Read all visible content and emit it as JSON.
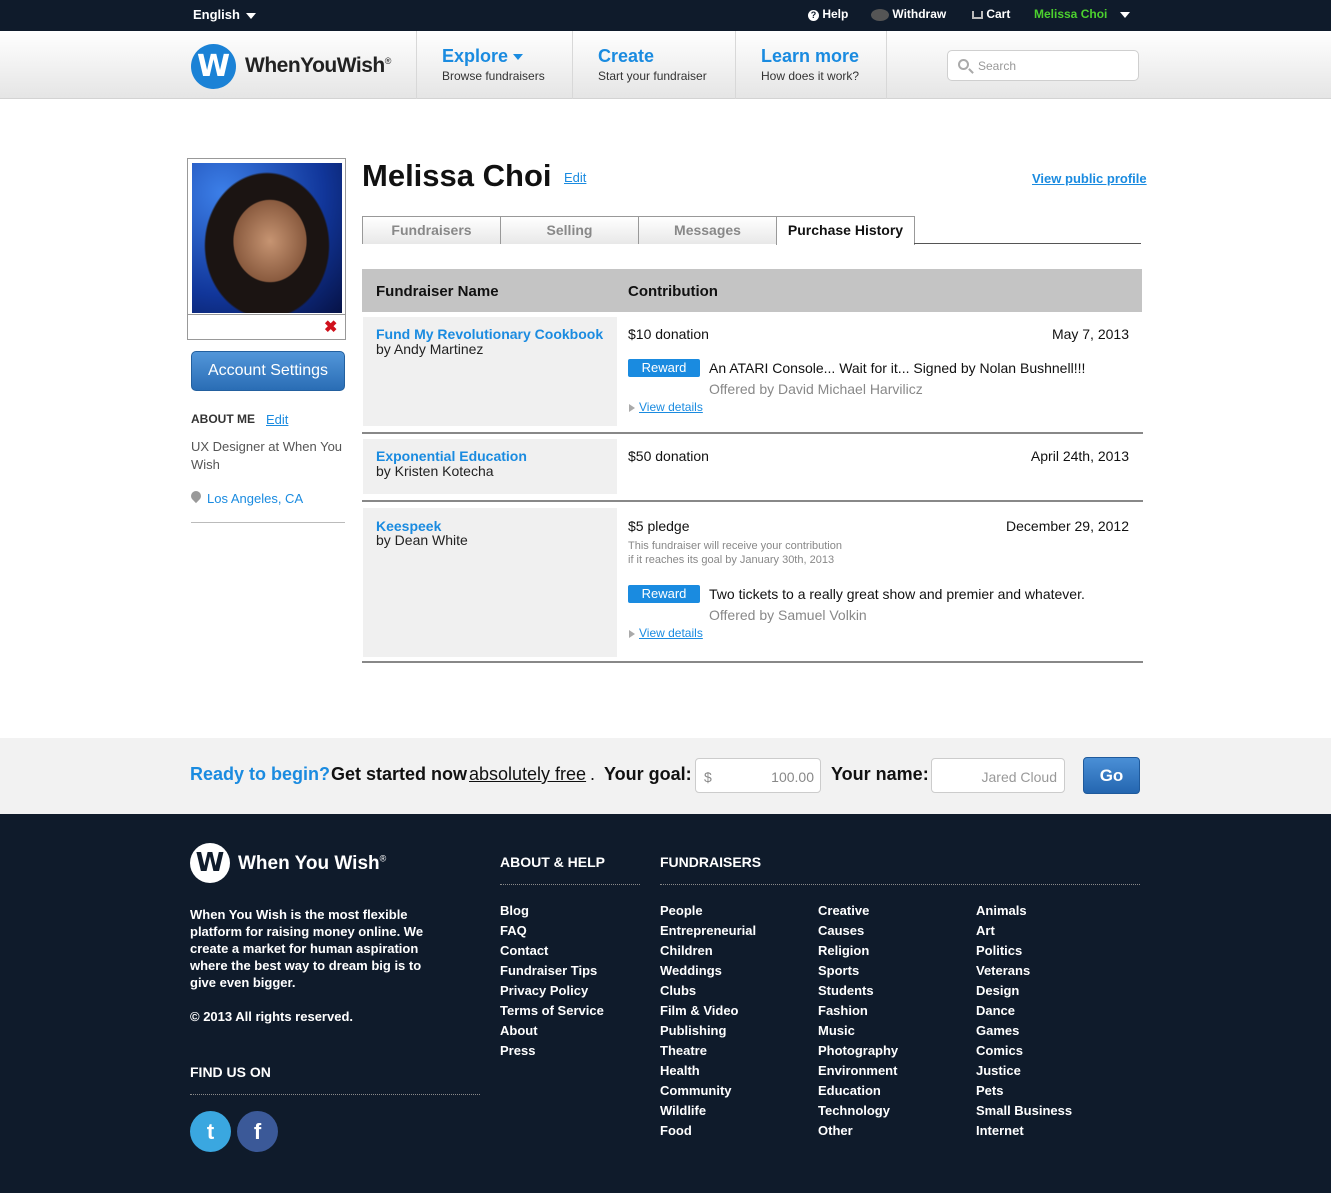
{
  "topbar": {
    "language": "English",
    "help": "Help",
    "withdraw": "Withdraw",
    "cart": "Cart",
    "user": "Melissa Choi"
  },
  "header": {
    "logo_letter": "W",
    "logo_text": "WhenYouWish",
    "registered": "®",
    "nav": [
      {
        "title": "Explore",
        "sub": "Browse fundraisers"
      },
      {
        "title": "Create",
        "sub": "Start your fundraiser"
      },
      {
        "title": "Learn more",
        "sub": "How does it work?"
      }
    ],
    "search_placeholder": "Search"
  },
  "sidebar": {
    "delete_icon": "✖",
    "account_settings": "Account Settings",
    "about_heading": "ABOUT ME",
    "about_edit": "Edit",
    "about_text": "UX Designer at When You Wish",
    "location": "Los Angeles, CA"
  },
  "profile": {
    "name": "Melissa Choi",
    "edit": "Edit",
    "view_public": "View public profile",
    "tabs": [
      "Fundraisers",
      "Selling",
      "Messages",
      "Purchase History"
    ],
    "active_tab": "Purchase History"
  },
  "table": {
    "headers": [
      "Fundraiser Name",
      "Contribution"
    ],
    "rows": [
      {
        "name": "Fund My Revolutionary Cookbook",
        "by": "by Andy Martinez",
        "amount": "$10 donation",
        "date": "May 7, 2013",
        "reward_label": "Reward",
        "reward": "An ATARI Console... Wait for it... Signed by Nolan Bushnell!!!",
        "offered": "Offered by David Michael Harvilicz",
        "view_details": "View details"
      },
      {
        "name": "Exponential Education",
        "by": "by Kristen Kotecha",
        "amount": "$50 donation",
        "date": "April 24th, 2013"
      },
      {
        "name": "Keespeek",
        "by": "by Dean White",
        "amount": "$5 pledge",
        "date": "December 29, 2012",
        "note_line1": "This fundraiser will receive your contribution",
        "note_line2": "if it reaches its goal by January 30th, 2013",
        "reward_label": "Reward",
        "reward": "Two tickets to a really great show and premier and whatever.",
        "offered": "Offered by Samuel Volkin",
        "view_details": "View details"
      }
    ]
  },
  "cta": {
    "ready": "Ready to begin?",
    "get_started": "Get started now",
    "free": "absolutely free",
    "dot": ".",
    "goal_label": "Your goal:",
    "currency": "$",
    "goal_value": "100.00",
    "name_label": "Your name:",
    "name_placeholder": "Jared Cloud",
    "go": "Go"
  },
  "footer": {
    "logo_letter": "W",
    "logo_text": "When You Wish",
    "registered": "®",
    "description": "When You Wish is the most flexible platform for raising money online. We create a market for human aspiration where the best way to dream big is to give even bigger.",
    "copyright": "© 2013 All rights reserved.",
    "find_us": "FIND US ON",
    "about_heading": "ABOUT & HELP",
    "about_links": [
      "Blog",
      "FAQ",
      "Contact",
      "Fundraiser Tips",
      "Privacy Policy",
      "Terms of Service",
      "About",
      "Press"
    ],
    "fundraisers_heading": "FUNDRAISERS",
    "fundraisers_col1": [
      "People",
      "Entrepreneurial",
      "Children",
      "Weddings",
      "Clubs",
      "Film & Video",
      "Publishing",
      "Theatre",
      "Health",
      "Community",
      "Wildlife",
      "Food"
    ],
    "fundraisers_col2": [
      "Creative",
      "Causes",
      "Religion",
      "Sports",
      "Students",
      "Fashion",
      "Music",
      "Photography",
      "Environment",
      "Education",
      "Technology",
      "Other"
    ],
    "fundraisers_col3": [
      "Animals",
      "Art",
      "Politics",
      "Veterans",
      "Design",
      "Dance",
      "Games",
      "Comics",
      "Justice",
      "Pets",
      "Small Business",
      "Internet"
    ],
    "social": [
      {
        "icon": "twitter-icon",
        "glyph": "t",
        "color": "#3aa7e0"
      },
      {
        "icon": "facebook-icon",
        "glyph": "f",
        "color": "#3b5998"
      }
    ]
  }
}
